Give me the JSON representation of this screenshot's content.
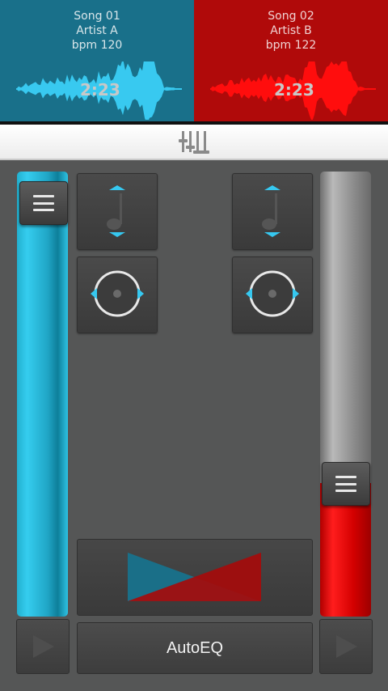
{
  "deck_a": {
    "song": "Song 01",
    "artist": "Artist A",
    "bpm": "bpm 120",
    "time": "2:23",
    "color": "#19708a",
    "wave_color": "#38c9f0"
  },
  "deck_b": {
    "song": "Song 02",
    "artist": "Artist B",
    "bpm": "bpm 122",
    "time": "2:23",
    "color": "#b00a0a",
    "wave_color": "#ff0d0d"
  },
  "toolbar": {
    "icon": "mixer-sliders-icon"
  },
  "fader_a": {
    "level": 1.0,
    "color": "#2bbfe2"
  },
  "fader_b": {
    "level": 0.3,
    "color": "#ff1d1d"
  },
  "pads": {
    "pitch_icon": "music-note-icon",
    "sync_icon": "record-disc-icon"
  },
  "crossfader": {
    "icon": "crossfade-triangles-icon"
  },
  "play_icon": "play-icon",
  "autoeq_label": "AutoEQ"
}
